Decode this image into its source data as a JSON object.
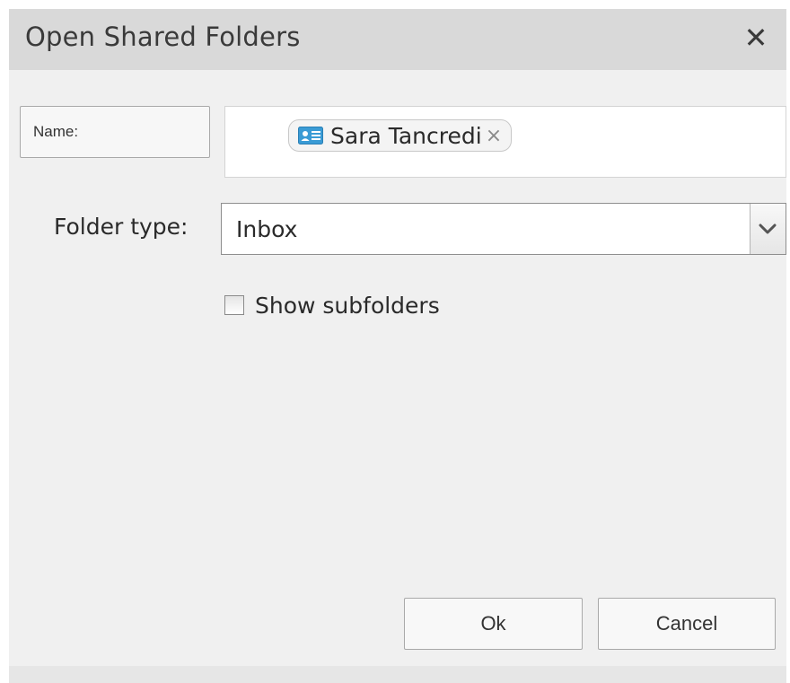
{
  "dialog": {
    "title": "Open Shared Folders",
    "close_icon": "close-icon",
    "close_glyph": "✕"
  },
  "name_button": {
    "label": "Name:"
  },
  "recipients": [
    {
      "name": "Sara Tancredi",
      "icon": "contact-card-icon",
      "remove_glyph": "×"
    }
  ],
  "folder_type": {
    "label": "Folder type:",
    "selected": "Inbox",
    "arrow_icon": "chevron-down-icon"
  },
  "show_subfolders": {
    "label": "Show subfolders",
    "checked": false
  },
  "buttons": {
    "ok": "Ok",
    "cancel": "Cancel"
  },
  "colors": {
    "contact_icon": "#3a9bd5",
    "titlebar": "#d9d9d9",
    "dialog_bg": "#f0f0f0"
  }
}
